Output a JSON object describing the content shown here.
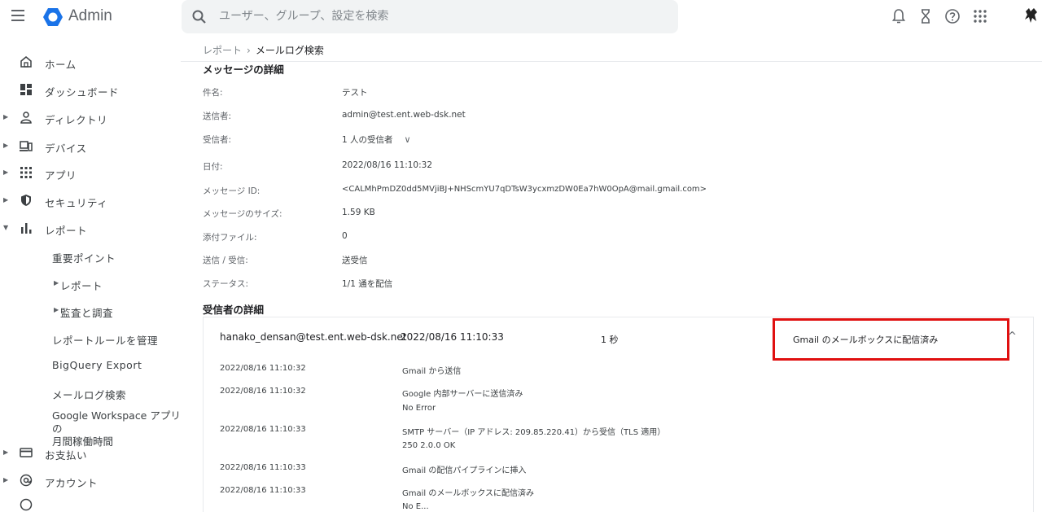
{
  "topbar": {
    "brand": "Admin",
    "search_placeholder": "ユーザー、グループ、設定を検索"
  },
  "icons": {
    "menu": "hamburger-icon",
    "bell": "notifications-icon",
    "hourglass": "tasks-icon",
    "help": "help-icon",
    "apps": "apps-grid-icon"
  },
  "sidebar": {
    "home": "ホーム",
    "dashboard": "ダッシュボード",
    "directory": "ディレクトリ",
    "devices": "デバイス",
    "apps": "アプリ",
    "security": "セキュリティ",
    "reports": "レポート",
    "highlights": "重要ポイント",
    "reports_sub": "レポート",
    "audit": "監査と調査",
    "manage_rules": "レポートルールを管理",
    "bigquery": "BigQuery Export",
    "email_log": "メールログ検索",
    "workspace_uptime_1": "Google Workspace アプリの",
    "workspace_uptime_2": "月間稼働時間",
    "billing": "お支払い",
    "account": "アカウント"
  },
  "breadcrumb": {
    "parent": "レポート",
    "separator": "›",
    "current": "メールログ検索"
  },
  "message": {
    "title": "メッセージの詳細",
    "rows": [
      {
        "label": "件名:",
        "value": "テスト"
      },
      {
        "label": "送信者:",
        "value": "admin@test.ent.web-dsk.net"
      },
      {
        "label": "受信者:",
        "value": "1 人の受信者"
      },
      {
        "label": "日付:",
        "value": "2022/08/16 11:10:32"
      },
      {
        "label": "メッセージ ID:",
        "value": "<CALMhPmDZ0dd5MVjiBJ+NHScmYU7qDTsW3ycxmzDW0Ea7hW0OpA@mail.gmail.com>"
      },
      {
        "label": "メッセージのサイズ:",
        "value": "1.59 KB"
      },
      {
        "label": "添付ファイル:",
        "value": "0"
      },
      {
        "label": "送信 / 受信:",
        "value": "送受信"
      },
      {
        "label": "ステータス:",
        "value": "1/1 通を配信"
      }
    ]
  },
  "recipients": {
    "title": "受信者の詳細",
    "row": {
      "email": "hanako_densan@test.ent.web-dsk.net",
      "time": "2022/08/16 11:10:33",
      "duration": "1 秒",
      "status": "Gmail のメールボックスに配信済み"
    },
    "events": [
      {
        "time": "2022/08/16 11:10:32",
        "text": "Gmail から送信",
        "sub": ""
      },
      {
        "time": "2022/08/16 11:10:32",
        "text": "Google 内部サーバーに送信済み",
        "sub": "No Error"
      },
      {
        "time": "2022/08/16 11:10:33",
        "text": "SMTP サーバー（IP アドレス: 209.85.220.41）から受信（TLS 適用）",
        "sub": "250 2.0.0 OK"
      },
      {
        "time": "2022/08/16 11:10:33",
        "text": "Gmail の配信パイプラインに挿入",
        "sub": ""
      },
      {
        "time": "2022/08/16 11:10:33",
        "text": "Gmail のメールボックスに配信済み",
        "sub": "No E..."
      }
    ]
  },
  "colors": {
    "highlight_box": "#e01010",
    "logo_blue": "#1a73e8"
  }
}
